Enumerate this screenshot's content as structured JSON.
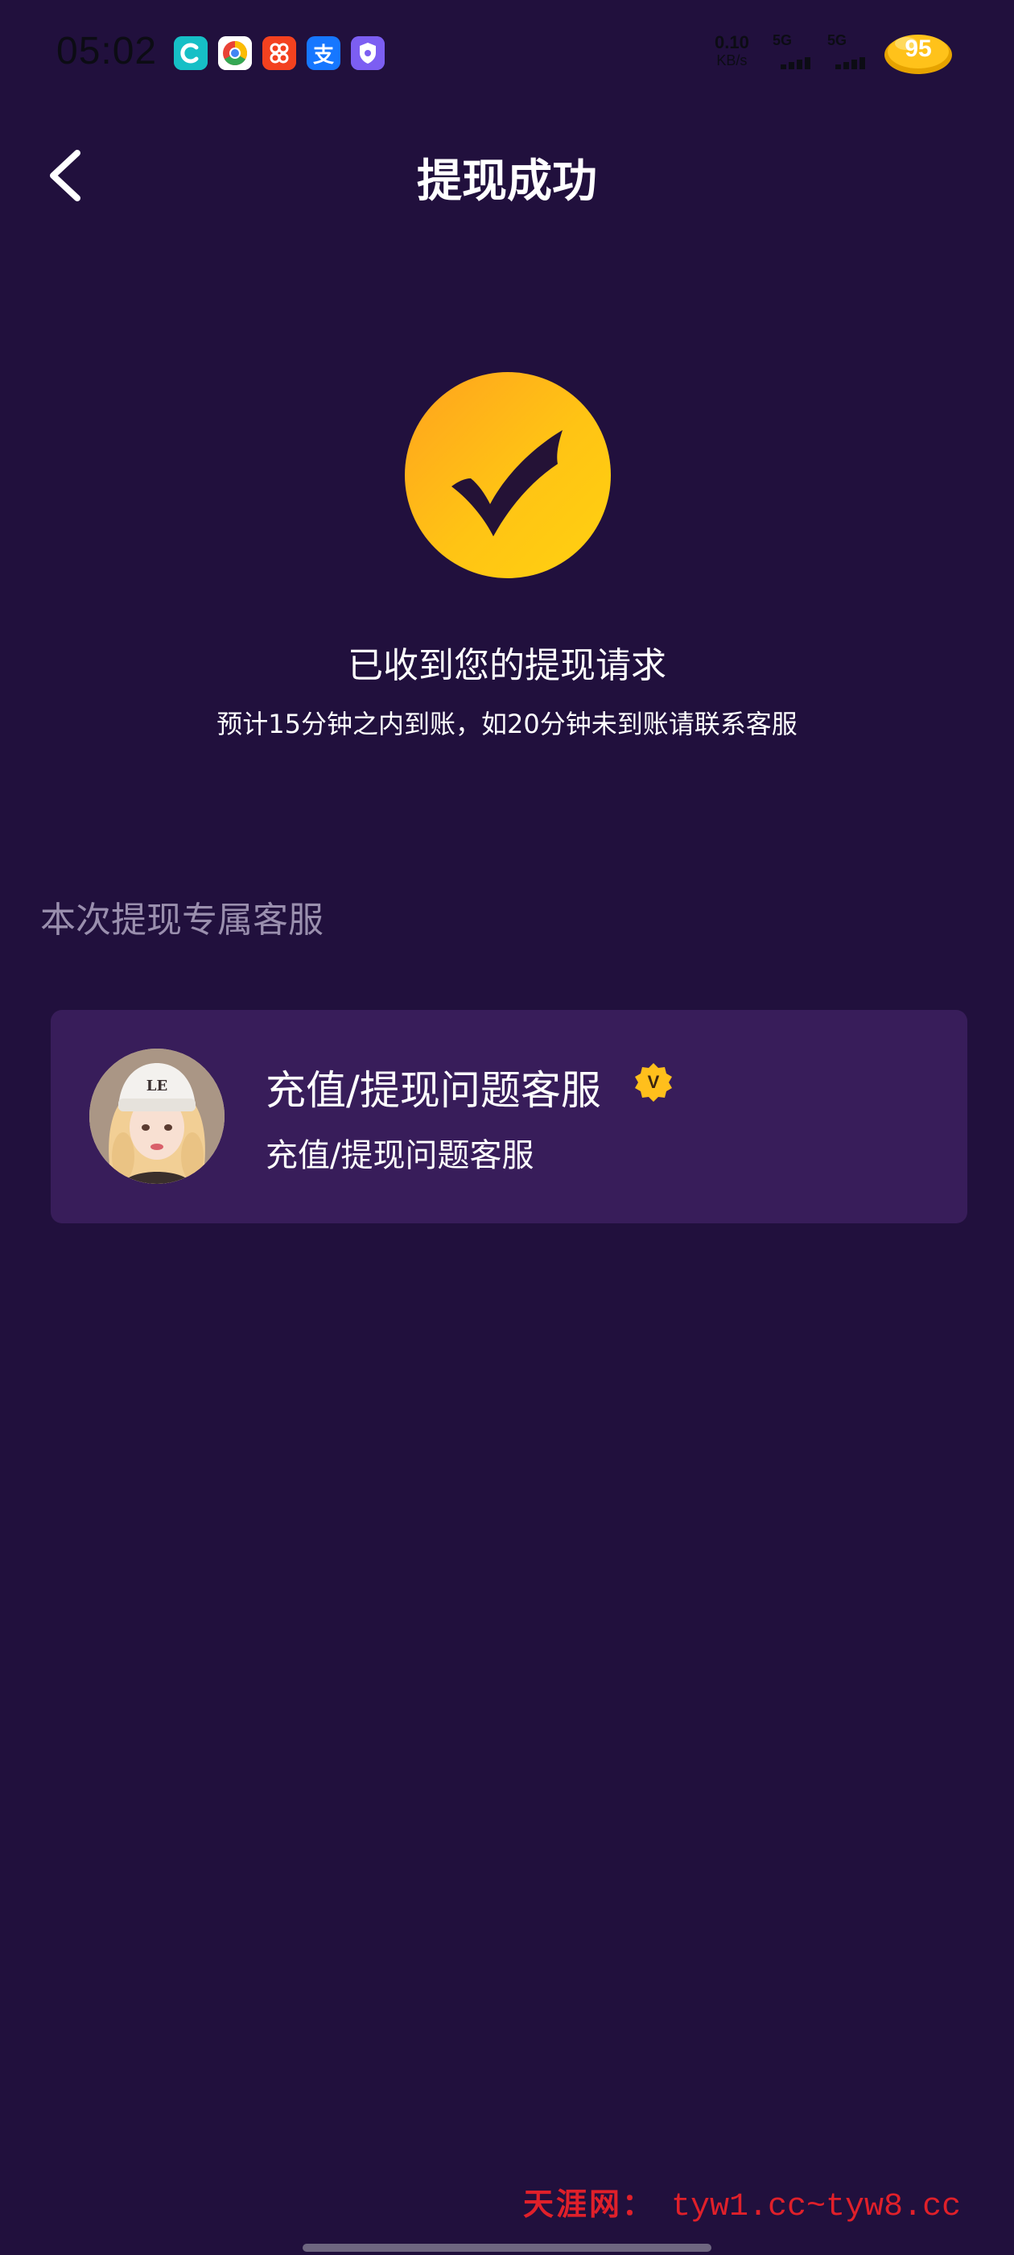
{
  "status_bar": {
    "time": "05:02",
    "app_icons": [
      {
        "name": "c-app-icon",
        "glyph": "C",
        "color": "#16bfc6"
      },
      {
        "name": "chrome-icon",
        "glyph": "",
        "color": "#ffffff"
      },
      {
        "name": "red-app-icon",
        "glyph": "8",
        "color": "#f3411f"
      },
      {
        "name": "alipay-icon",
        "glyph": "支",
        "color": "#1677ff"
      },
      {
        "name": "shield-app-icon",
        "glyph": "",
        "color": "#7c5ef2"
      }
    ],
    "net_speed": "0.10",
    "net_unit": "KB/s",
    "signal_1_label": "5G",
    "signal_2_label": "5G",
    "battery_level": "95"
  },
  "nav": {
    "title": "提现成功"
  },
  "success": {
    "title": "已收到您的提现请求",
    "subtitle": "预计15分钟之内到账，如20分钟未到账请联系客服"
  },
  "section": {
    "title": "本次提现专属客服"
  },
  "service_card": {
    "name": "充值/提现问题客服",
    "verified_badge": "V",
    "description": "充值/提现问题客服",
    "avatar_caption": "LE"
  },
  "watermark": {
    "site_name": "天涯网：",
    "url": "tyw1.cc~tyw8.cc"
  },
  "colors": {
    "background": "#21103d",
    "card": "#381d5a",
    "accent": "#ffc414",
    "section_title": "#9a8fae",
    "watermark": "#e0202a"
  }
}
